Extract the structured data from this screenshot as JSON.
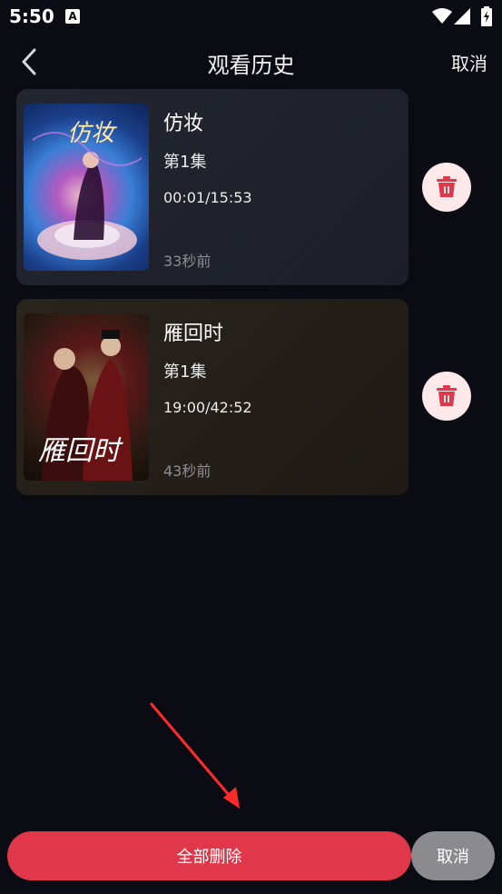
{
  "status_bar": {
    "time": "5:50",
    "notification_letter": "A"
  },
  "header": {
    "title": "观看历史",
    "cancel_label": "取消"
  },
  "history": [
    {
      "title": "仿妆",
      "episode": "第1集",
      "progress": "00:01/15:53",
      "time_ago": "33秒前",
      "poster_text": "仿妆"
    },
    {
      "title": "雁回时",
      "episode": "第1集",
      "progress": "19:00/42:52",
      "time_ago": "43秒前",
      "poster_text": "雁回时"
    }
  ],
  "footer": {
    "delete_all_label": "全部删除",
    "cancel_label": "取消"
  },
  "colors": {
    "accent": "#e0374a",
    "background": "#0b0b14",
    "delete_bg": "#fde8ea",
    "cancel_gray": "#8a8a8f"
  },
  "icons": [
    "back-chevron-icon",
    "trash-icon",
    "wifi-icon",
    "signal-icon",
    "battery-icon"
  ]
}
